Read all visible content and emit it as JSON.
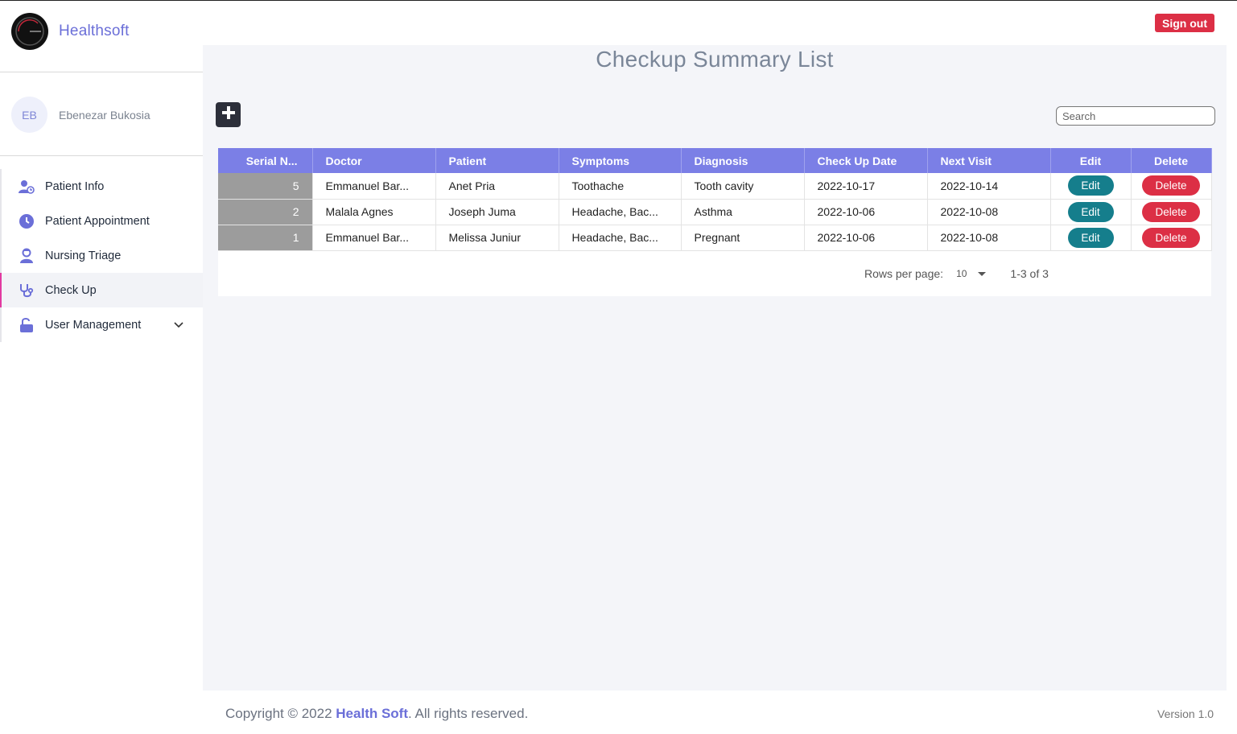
{
  "brand": {
    "name": "Healthsoft",
    "logo_icon": "dark-circle-logo-icon"
  },
  "header": {
    "sign_out_label": "Sign out"
  },
  "profile": {
    "initials": "EB",
    "name": "Ebenezar Bukosia"
  },
  "sidebar": {
    "items": [
      {
        "label": "Patient Info",
        "icon": "users-icon",
        "active": false
      },
      {
        "label": "Patient Appointment",
        "icon": "clock-icon",
        "active": false
      },
      {
        "label": "Nursing Triage",
        "icon": "nurse-icon",
        "active": false
      },
      {
        "label": "Check Up",
        "icon": "stethoscope-icon",
        "active": true
      },
      {
        "label": "User Management",
        "icon": "unlock-icon",
        "active": false,
        "expandable": true
      }
    ]
  },
  "main": {
    "title": "Checkup Summary List",
    "search": {
      "placeholder": "Search",
      "value": ""
    },
    "table": {
      "columns": [
        "Serial N...",
        "Doctor",
        "Patient",
        "Symptoms",
        "Diagnosis",
        "Check Up Date",
        "Next Visit",
        "Edit",
        "Delete"
      ],
      "rows": [
        {
          "serial": "5",
          "doctor": "Emmanuel Bar...",
          "patient": "Anet Pria",
          "symptoms": "Toothache",
          "diagnosis": "Tooth cavity",
          "checkup_date": "2022-10-17",
          "next_visit": "2022-10-14",
          "edit": "Edit",
          "delete": "Delete"
        },
        {
          "serial": "2",
          "doctor": "Malala Agnes",
          "patient": "Joseph Juma",
          "symptoms": "Headache, Bac...",
          "diagnosis": "Asthma",
          "checkup_date": "2022-10-06",
          "next_visit": "2022-10-08",
          "edit": "Edit",
          "delete": "Delete"
        },
        {
          "serial": "1",
          "doctor": "Emmanuel Bar...",
          "patient": "Melissa Juniur",
          "symptoms": "Headache, Bac...",
          "diagnosis": "Pregnant",
          "checkup_date": "2022-10-06",
          "next_visit": "2022-10-08",
          "edit": "Edit",
          "delete": "Delete"
        }
      ]
    },
    "pagination": {
      "rows_per_page_label": "Rows per page:",
      "rows_per_page_value": "10",
      "range": "1-3 of 3"
    }
  },
  "footer": {
    "copyright_prefix": "Copyright © 2022 ",
    "brand": "Health Soft",
    "copyright_suffix": ". All rights reserved.",
    "version": "Version 1.0"
  },
  "colors": {
    "accent": "#7b7fe6",
    "brand_text": "#6b6fd8",
    "danger": "#dc2f45",
    "edit": "#157e8c",
    "active_marker": "#e23aa0"
  }
}
